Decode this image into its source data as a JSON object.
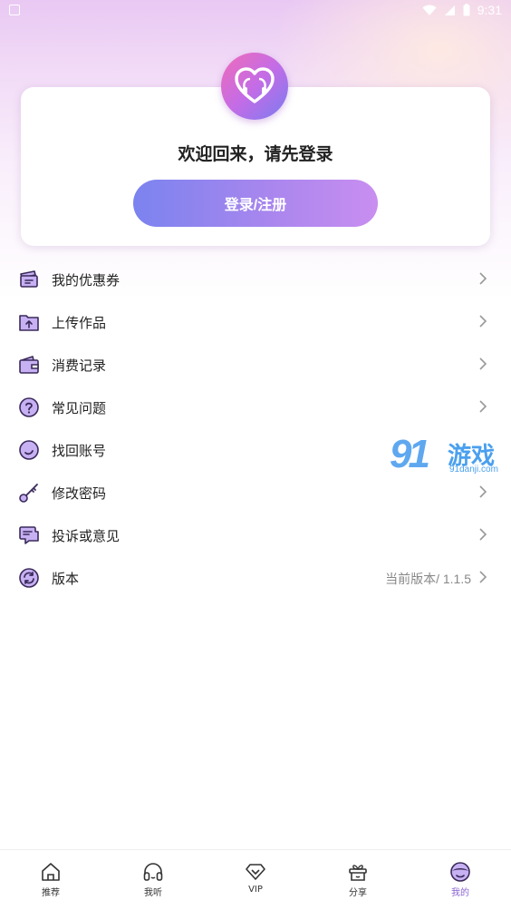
{
  "status_bar": {
    "time": "9:31"
  },
  "profile_card": {
    "welcome_text": "欢迎回来，请先登录",
    "login_button": "登录/注册"
  },
  "menu": [
    {
      "label": "我的优惠券",
      "icon": "coupon-icon"
    },
    {
      "label": "上传作品",
      "icon": "upload-folder-icon"
    },
    {
      "label": "消费记录",
      "icon": "wallet-icon"
    },
    {
      "label": "常见问题",
      "icon": "question-icon"
    },
    {
      "label": "找回账号",
      "icon": "recover-account-icon"
    },
    {
      "label": "修改密码",
      "icon": "key-icon"
    },
    {
      "label": "投诉或意见",
      "icon": "feedback-icon"
    },
    {
      "label": "版本",
      "icon": "refresh-icon",
      "extra": "当前版本/ 1.1.5"
    }
  ],
  "watermark": {
    "brand": "91",
    "brand_text": "游戏",
    "url": "91danji.com"
  },
  "tabbar": [
    {
      "label": "推荐",
      "icon": "home-icon"
    },
    {
      "label": "我听",
      "icon": "headphones-icon"
    },
    {
      "label": "VIP",
      "icon": "diamond-icon"
    },
    {
      "label": "分享",
      "icon": "gift-box-icon"
    },
    {
      "label": "我的",
      "icon": "profile-icon",
      "active": true
    }
  ],
  "colors": {
    "accent": "#8a63d2",
    "icon_fill": "#c7b1f3",
    "icon_stroke": "#3a2a5a"
  }
}
